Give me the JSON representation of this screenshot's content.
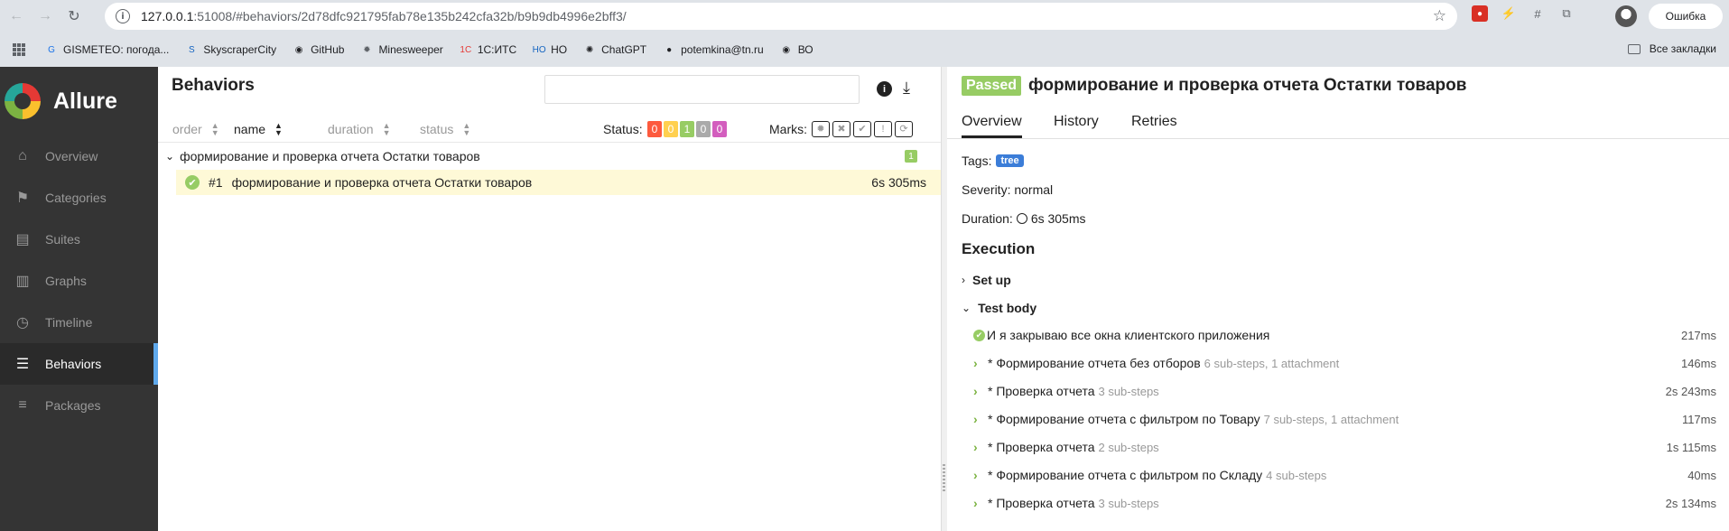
{
  "browser": {
    "url_host": "127.0.0.1",
    "url_path": ":51008/#behaviors/2d78dfc921795fab78e135b242cfa32b/b9b9db4996e2bff3/",
    "profile_label": "Ошибка",
    "bookmarks": [
      {
        "label": "GISMETEO: погода...",
        "icon": "G",
        "color": "#1a73e8"
      },
      {
        "label": "SkyscraperCity",
        "icon": "S",
        "color": "#1565c0"
      },
      {
        "label": "GitHub",
        "icon": "◉",
        "color": "#202124"
      },
      {
        "label": "Minesweeper",
        "icon": "✹",
        "color": "#5f6368"
      },
      {
        "label": "1С:ИТС",
        "icon": "1С",
        "color": "#e53935"
      },
      {
        "label": "НО",
        "icon": "НО",
        "color": "#1565c0"
      },
      {
        "label": "ChatGPT",
        "icon": "✺",
        "color": "#202124"
      },
      {
        "label": "potemkina@tn.ru",
        "icon": "●",
        "color": "#202124"
      },
      {
        "label": "ВО",
        "icon": "◉",
        "color": "#202124"
      }
    ],
    "all_bookmarks_label": "Все закладки"
  },
  "sidebar": {
    "brand": "Allure",
    "items": [
      {
        "label": "Overview",
        "icon": "home-icon",
        "glyph": "⌂",
        "active": false
      },
      {
        "label": "Categories",
        "icon": "flag-icon",
        "glyph": "⚑",
        "active": false
      },
      {
        "label": "Suites",
        "icon": "briefcase-icon",
        "glyph": "▤",
        "active": false
      },
      {
        "label": "Graphs",
        "icon": "bar-chart-icon",
        "glyph": "▥",
        "active": false
      },
      {
        "label": "Timeline",
        "icon": "clock-icon",
        "glyph": "◷",
        "active": false
      },
      {
        "label": "Behaviors",
        "icon": "list-icon",
        "glyph": "☰",
        "active": true
      },
      {
        "label": "Packages",
        "icon": "align-left-icon",
        "glyph": "≡",
        "active": false
      }
    ]
  },
  "behaviors": {
    "title": "Behaviors",
    "search_value": "",
    "sort": {
      "order": "order",
      "name": "name",
      "duration": "duration",
      "status": "status"
    },
    "status_label": "Status:",
    "status_counts": [
      {
        "value": "0",
        "color": "#fd5a3e"
      },
      {
        "value": "0",
        "color": "#ffd050"
      },
      {
        "value": "1",
        "color": "#97cc64"
      },
      {
        "value": "0",
        "color": "#aaaaaa"
      },
      {
        "value": "0",
        "color": "#d35ebe"
      }
    ],
    "marks_label": "Marks:",
    "group": {
      "name": "формирование и проверка отчета Остатки товаров",
      "count": "1"
    },
    "test": {
      "number": "#1",
      "name": "формирование и проверка отчета Остатки товаров",
      "duration": "6s 305ms"
    }
  },
  "details": {
    "status": "Passed",
    "title": "формирование и проверка отчета Остатки товаров",
    "tabs": [
      "Overview",
      "History",
      "Retries"
    ],
    "tags_label": "Tags:",
    "tag": "tree",
    "severity": "Severity: normal",
    "duration_label": "Duration:",
    "duration": "6s 305ms",
    "execution_title": "Execution",
    "setup_label": "Set up",
    "testbody_label": "Test body",
    "steps": [
      {
        "name": "И я закрываю все окна клиентского приложения",
        "meta": "",
        "duration": "217ms",
        "type": "ok"
      },
      {
        "name": "* Формирование отчета без отборов",
        "meta": "6 sub-steps, 1 attachment",
        "duration": "146ms",
        "type": "expand"
      },
      {
        "name": "* Проверка отчета",
        "meta": "3 sub-steps",
        "duration": "2s 243ms",
        "type": "expand"
      },
      {
        "name": "* Формирование отчета с фильтром по Товару",
        "meta": "7 sub-steps, 1 attachment",
        "duration": "117ms",
        "type": "expand"
      },
      {
        "name": "* Проверка отчета",
        "meta": "2 sub-steps",
        "duration": "1s 115ms",
        "type": "expand"
      },
      {
        "name": "* Формирование отчета с фильтром по Складу",
        "meta": "4 sub-steps",
        "duration": "40ms",
        "type": "expand"
      },
      {
        "name": "* Проверка отчета",
        "meta": "3 sub-steps",
        "duration": "2s 134ms",
        "type": "expand"
      }
    ]
  }
}
